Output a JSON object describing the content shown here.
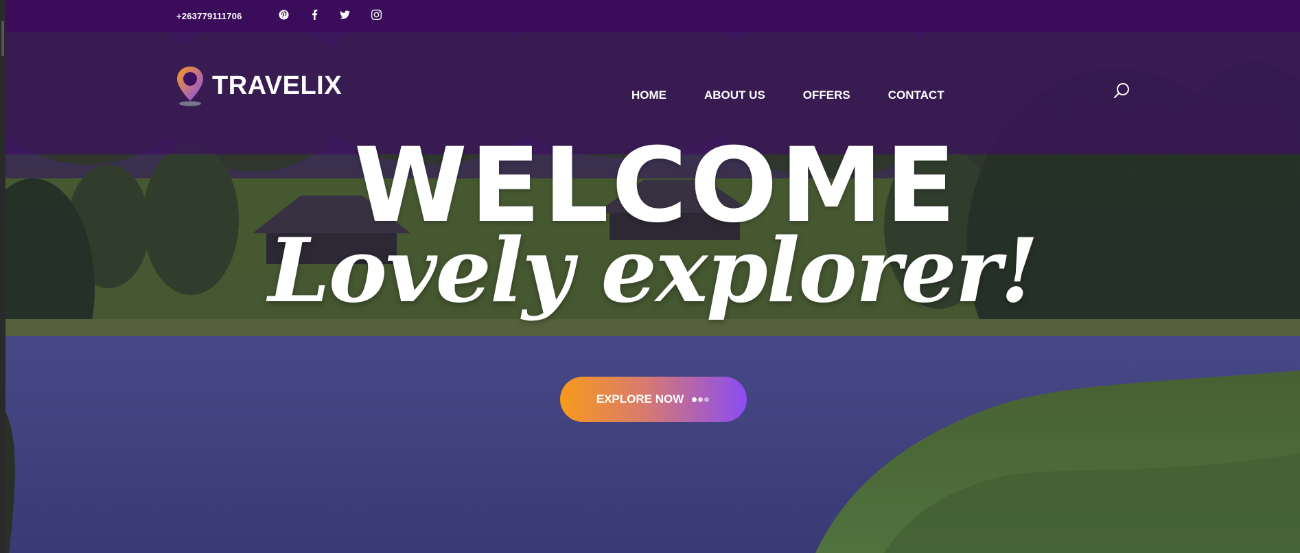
{
  "topbar": {
    "phone": "+263779111706",
    "social": [
      {
        "icon": "pinterest-icon"
      },
      {
        "icon": "facebook-icon"
      },
      {
        "icon": "twitter-icon"
      },
      {
        "icon": "instagram-icon"
      }
    ]
  },
  "header": {
    "logo_text": "TRAVELIX",
    "nav": [
      "HOME",
      "ABOUT US",
      "OFFERS",
      "CONTACT"
    ],
    "search_icon": "search-icon"
  },
  "hero": {
    "headline": "WELCOME",
    "subheadline": "Lovely explorer!",
    "cta_label": "EXPLORE NOW"
  },
  "colors": {
    "topbar": "#3a0c5a",
    "header_overlay": "#3c1060",
    "cta_start": "#f79a1c",
    "cta_end": "#8a4cf4"
  }
}
